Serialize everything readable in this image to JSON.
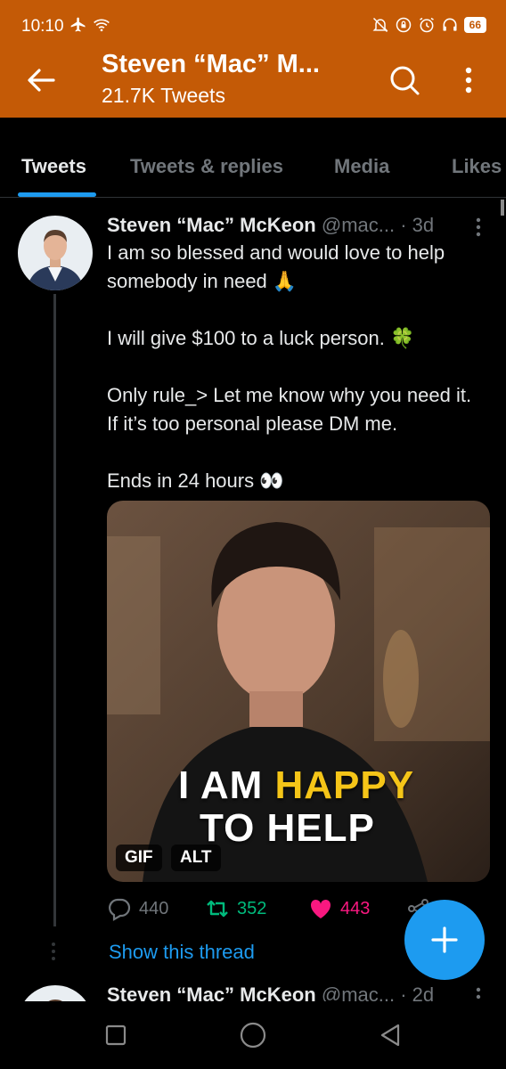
{
  "status_bar": {
    "time": "10:10",
    "battery": "66"
  },
  "header": {
    "title": "Steven “Mac” M...",
    "subtitle": "21.7K Tweets"
  },
  "tabs": [
    {
      "label": "Tweets",
      "active": true
    },
    {
      "label": "Tweets & replies",
      "active": false
    },
    {
      "label": "Media",
      "active": false
    },
    {
      "label": "Likes",
      "active": false
    }
  ],
  "tweet": {
    "name": "Steven “Mac” McKeon",
    "handle": "@mac...",
    "separator": "·",
    "time": "3d",
    "lines": [
      "I am so blessed and would love to help somebody in need 🙏",
      "I will give $100 to a luck person. 🍀",
      "Only rule_> Let me know why you need it. If it’s too personal please DM me.",
      "Ends in 24 hours 👀"
    ],
    "media": {
      "caption_part1": "I AM ",
      "caption_highlight": "HAPPY",
      "caption_part2": "TO HELP",
      "gif_badge": "GIF",
      "alt_badge": "ALT"
    },
    "replies": "440",
    "retweets": "352",
    "likes": "443",
    "show_thread": "Show this thread"
  },
  "tweet2": {
    "name": "Steven “Mac” McKeon",
    "handle": "@mac...",
    "separator": "·",
    "time": "2d"
  },
  "colors": {
    "header_bg": "#c45a06",
    "accent": "#1d9bf0",
    "retweet": "#00ba7c",
    "like": "#f91880",
    "gif_yellow": "#f5c518"
  }
}
